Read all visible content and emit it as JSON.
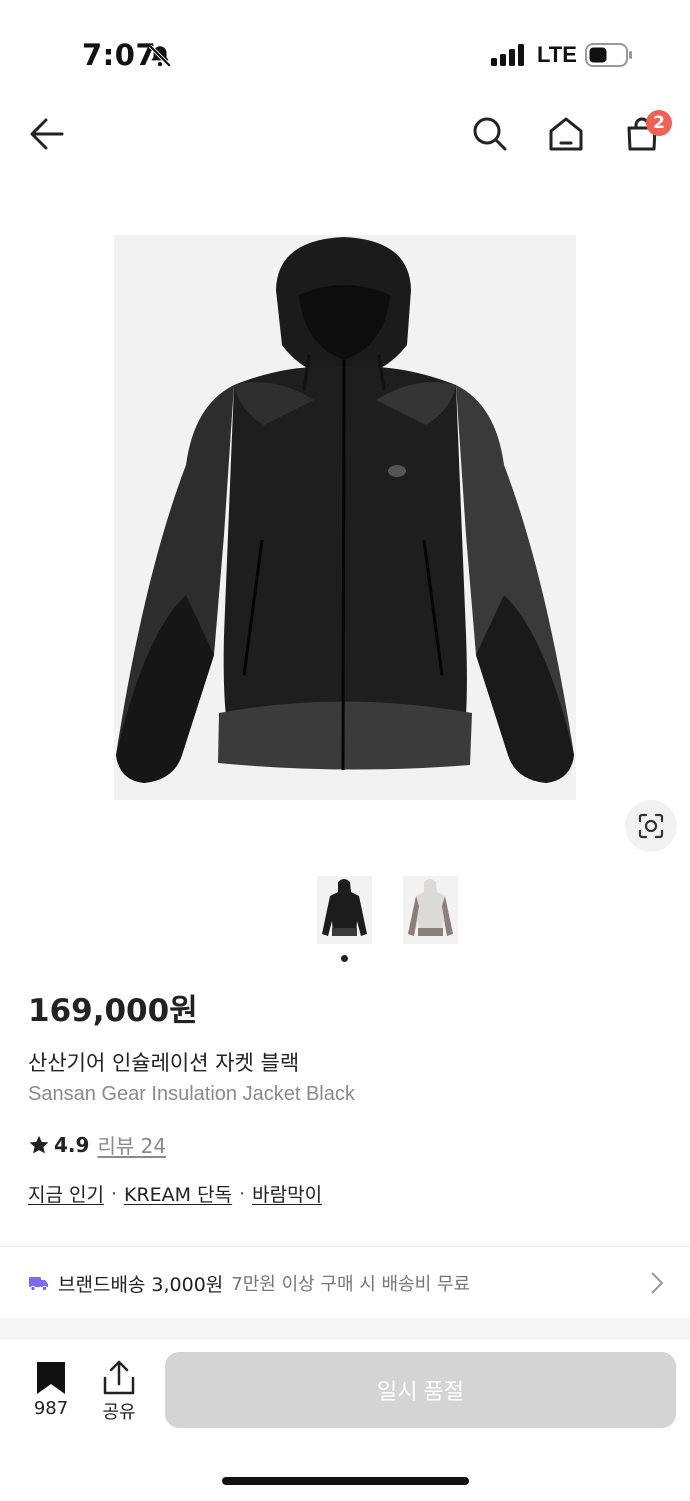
{
  "status_bar": {
    "time": "7:07",
    "network": "LTE",
    "icons": [
      "bell-slash-icon",
      "signal-icon",
      "battery-icon"
    ]
  },
  "nav": {
    "icons": [
      "back-arrow-icon",
      "search-icon",
      "home-icon",
      "shopping-bag-icon"
    ],
    "cart_count": "2"
  },
  "gallery": {
    "thumbnail_count": 2,
    "active_index": 0,
    "lens_icon": "visual-search-icon"
  },
  "product": {
    "price": "169,000원",
    "name_ko": "산산기어 인슐레이션 자켓 블랙",
    "name_en": "Sansan Gear Insulation Jacket Black",
    "rating": "4.9",
    "review_label": "리뷰 24",
    "tags": [
      "지금 인기",
      "KREAM 단독",
      "바람막이"
    ],
    "tag_separator": "·"
  },
  "shipping": {
    "label": "브랜드배송",
    "price": "3,000원",
    "note": "7만원 이상 구매 시 배송비 무료",
    "icon": "truck-icon",
    "accent_color": "#7a6cf0"
  },
  "bottom_bar": {
    "bookmark_count": "987",
    "share_label": "공유",
    "main_button_label": "일시 품절",
    "main_button_color": "#d4d4d4"
  }
}
